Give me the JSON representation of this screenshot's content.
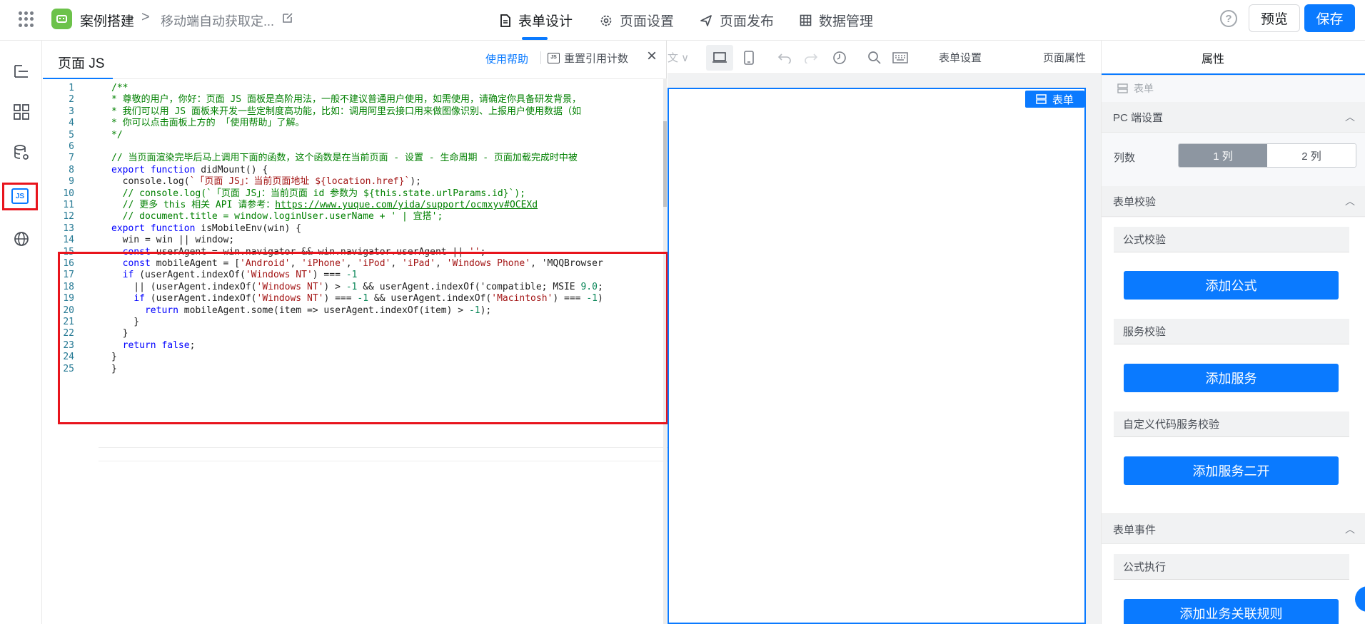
{
  "header": {
    "app_name": "案例搭建",
    "breadcrumb_sep": ">",
    "page_name": "移动端自动获取定...",
    "nav": [
      {
        "label": "表单设计",
        "icon": "document-icon",
        "active": true
      },
      {
        "label": "页面设置",
        "icon": "gear-icon",
        "active": false
      },
      {
        "label": "页面发布",
        "icon": "send-icon",
        "active": false
      },
      {
        "label": "数据管理",
        "icon": "table-icon",
        "active": false
      }
    ],
    "help": "?",
    "preview": "预览",
    "save": "保存",
    "accent": "#0a7aff"
  },
  "left_sidebar": {
    "items": [
      "outline-icon",
      "components-icon",
      "datasource-icon",
      "js-icon",
      "globe-icon"
    ],
    "js_badge": "JS",
    "highlight_color": "#e8141c"
  },
  "js_panel": {
    "title": "页面 JS",
    "use_help": "使用帮助",
    "reset_count": "重置引用计数",
    "reset_count_badge": "JS",
    "close": "×",
    "code_lines": [
      {
        "n": "1",
        "t": "/**"
      },
      {
        "n": "2",
        "t": "* 尊敬的用户，你好：页面 JS 面板是高阶用法，一般不建议普通用户使用，如需使用，请确定你具备研发背景，"
      },
      {
        "n": "3",
        "t": "* 我们可以用 JS 面板来开发一些定制度高功能，比如：调用阿里云接口用来做图像识别、上报用户使用数据（如"
      },
      {
        "n": "4",
        "t": "* 你可以点击面板上方的 「使用帮助」了解。"
      },
      {
        "n": "5",
        "t": "*/"
      },
      {
        "n": "6",
        "t": ""
      },
      {
        "n": "7",
        "t": "// 当页面渲染完毕后马上调用下面的函数，这个函数是在当前页面 - 设置 - 生命周期 - 页面加载完成时中被"
      },
      {
        "n": "8",
        "t": "export function didMount() {"
      },
      {
        "n": "9",
        "t": "  console.log(`「页面 JS」：当前页面地址 ${location.href}`);"
      },
      {
        "n": "10",
        "t": "  // console.log(`「页面 JS」：当前页面 id 参数为 ${this.state.urlParams.id}`);"
      },
      {
        "n": "11",
        "t": "  // 更多 this 相关 API 请参考：https://www.yuque.com/yida/support/ocmxyv#OCEXd"
      },
      {
        "n": "12",
        "t": "  // document.title = window.loginUser.userName + ' | 宜搭';"
      },
      {
        "n": "13",
        "t": "export function isMobileEnv(win) {"
      },
      {
        "n": "14",
        "t": "  win = win || window;"
      },
      {
        "n": "15",
        "t": "  const userAgent = win.navigator && win.navigator.userAgent || '';"
      },
      {
        "n": "16",
        "t": "  const mobileAgent = ['Android', 'iPhone', 'iPod', 'iPad', 'Windows Phone', 'MQQBrowser"
      },
      {
        "n": "17",
        "t": "  if (userAgent.indexOf('Windows NT') === -1"
      },
      {
        "n": "18",
        "t": "    || (userAgent.indexOf('Windows NT') > -1 && userAgent.indexOf('compatible; MSIE 9.0;"
      },
      {
        "n": "19",
        "t": "    if (userAgent.indexOf('Windows NT') === -1 && userAgent.indexOf('Macintosh') === -1)"
      },
      {
        "n": "20",
        "t": "      return mobileAgent.some(item => userAgent.indexOf(item) > -1);"
      },
      {
        "n": "21",
        "t": "    }"
      },
      {
        "n": "22",
        "t": "  }"
      },
      {
        "n": "23",
        "t": "  return false;"
      },
      {
        "n": "24",
        "t": "}"
      },
      {
        "n": "25",
        "t": "}"
      }
    ]
  },
  "canvas": {
    "toolbar_form_settings": "表单设置",
    "toolbar_page_props": "页面属性",
    "form_tag": "表单"
  },
  "right_panel": {
    "tab": "属性",
    "form_label": "表单",
    "pc_settings": "PC 端设置",
    "columns_label": "列数",
    "columns_options": [
      "1 列",
      "2 列"
    ],
    "columns_selected": "1 列",
    "form_validation": "表单校验",
    "formula_validation": "公式校验",
    "add_formula": "添加公式",
    "service_validation": "服务校验",
    "add_service": "添加服务",
    "custom_code_validation": "自定义代码服务校验",
    "add_service_2": "添加服务二开",
    "form_events": "表单事件",
    "formula_exec": "公式执行",
    "add_relation_rule": "添加业务关联规则"
  }
}
